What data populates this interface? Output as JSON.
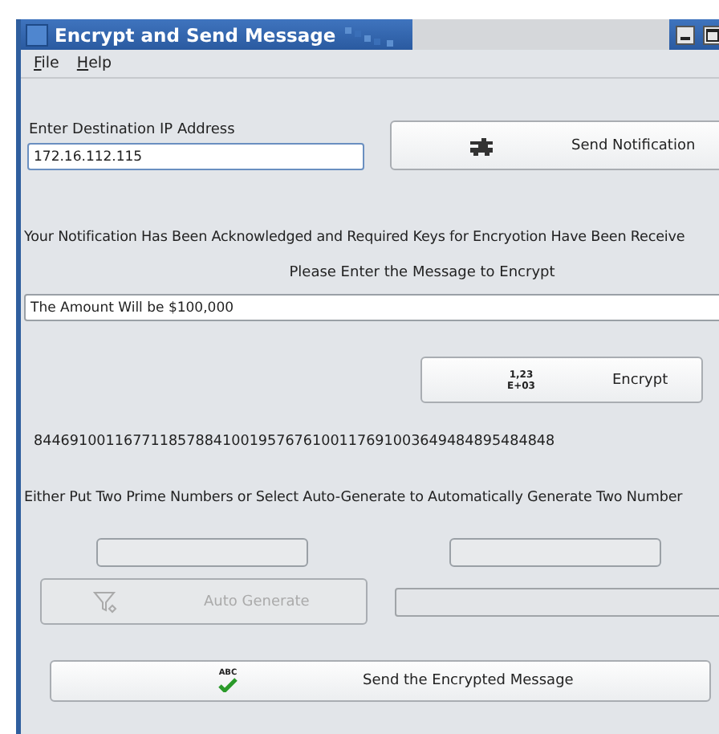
{
  "window": {
    "title": "Encrypt and Send Message"
  },
  "menu": [
    {
      "label": "File"
    },
    {
      "label": "Help"
    }
  ],
  "ip": {
    "label": "Enter Destination IP Address",
    "value": "172.16.112.115"
  },
  "send_notification_button": {
    "label": "Send Notification",
    "disabled": false
  },
  "notification_text": "Your Notification Has Been Acknowledged and Required Keys for Encryotion Have Been Receive",
  "message_prompt": "Please Enter the Message to Encrypt",
  "message": {
    "value": "The Amount Will be $100,000"
  },
  "encrypt_button": {
    "label": "Encrypt",
    "icon_text": [
      "1,23",
      "E+03"
    ],
    "disabled": false
  },
  "encrypted_output": "8446910011677118578841001957676100117691003649484895484848",
  "prime_prompt": "Either Put Two Prime Numbers or Select Auto-Generate to Automatically Generate Two Number",
  "prime_fields": [
    {
      "kind": "input"
    },
    {
      "kind": "input"
    }
  ],
  "auto_generate_button": {
    "label": "Auto Generate",
    "disabled": true
  },
  "auto_field": {
    "disabled": true
  },
  "send_encrypted_button": {
    "label": "Send the Encrypted Message",
    "icon_text": "ABC",
    "disabled": false
  }
}
